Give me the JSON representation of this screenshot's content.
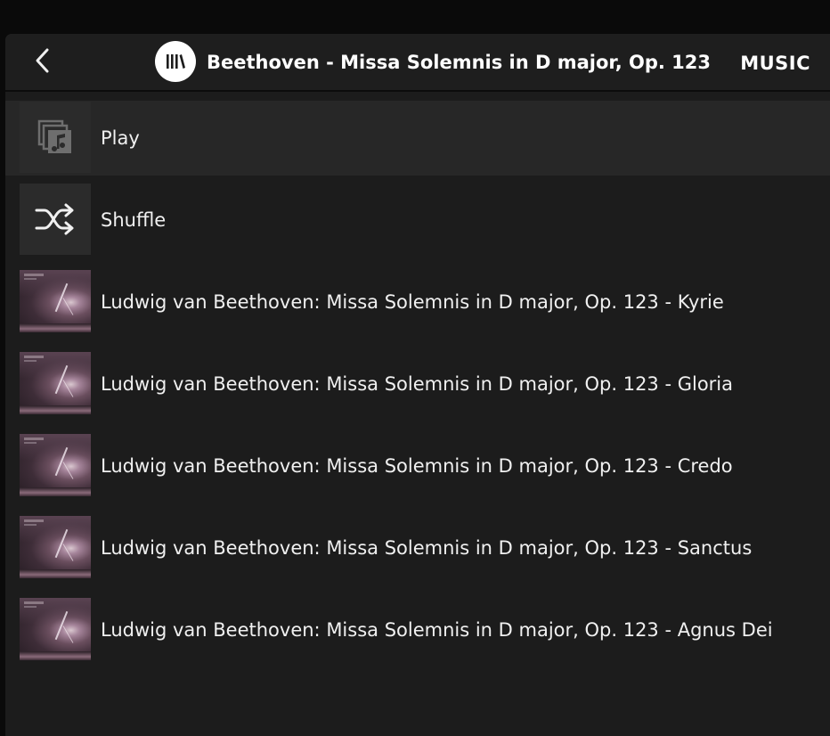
{
  "header": {
    "back_icon": "chevron-left-icon",
    "library_icon": "library-icon",
    "title": "Beethoven - Missa Solemnis in D major, Op. 123",
    "section": "MUSIC"
  },
  "actions": [
    {
      "label": "Play",
      "icon": "music-library-icon"
    },
    {
      "label": "Shuffle",
      "icon": "shuffle-icon"
    }
  ],
  "tracks": [
    {
      "label": "Ludwig van Beethoven: Missa Solemnis in D major, Op. 123 - Kyrie"
    },
    {
      "label": "Ludwig van Beethoven: Missa Solemnis in D major, Op. 123 - Gloria"
    },
    {
      "label": "Ludwig van Beethoven: Missa Solemnis in D major, Op. 123 - Credo"
    },
    {
      "label": "Ludwig van Beethoven: Missa Solemnis in D major, Op. 123 - Sanctus"
    },
    {
      "label": "Ludwig van Beethoven: Missa Solemnis in D major, Op. 123 - Agnus Dei"
    }
  ],
  "colors": {
    "background": "#1c1c1c",
    "highlight_row": "#272727",
    "text": "#f0f0f0"
  }
}
